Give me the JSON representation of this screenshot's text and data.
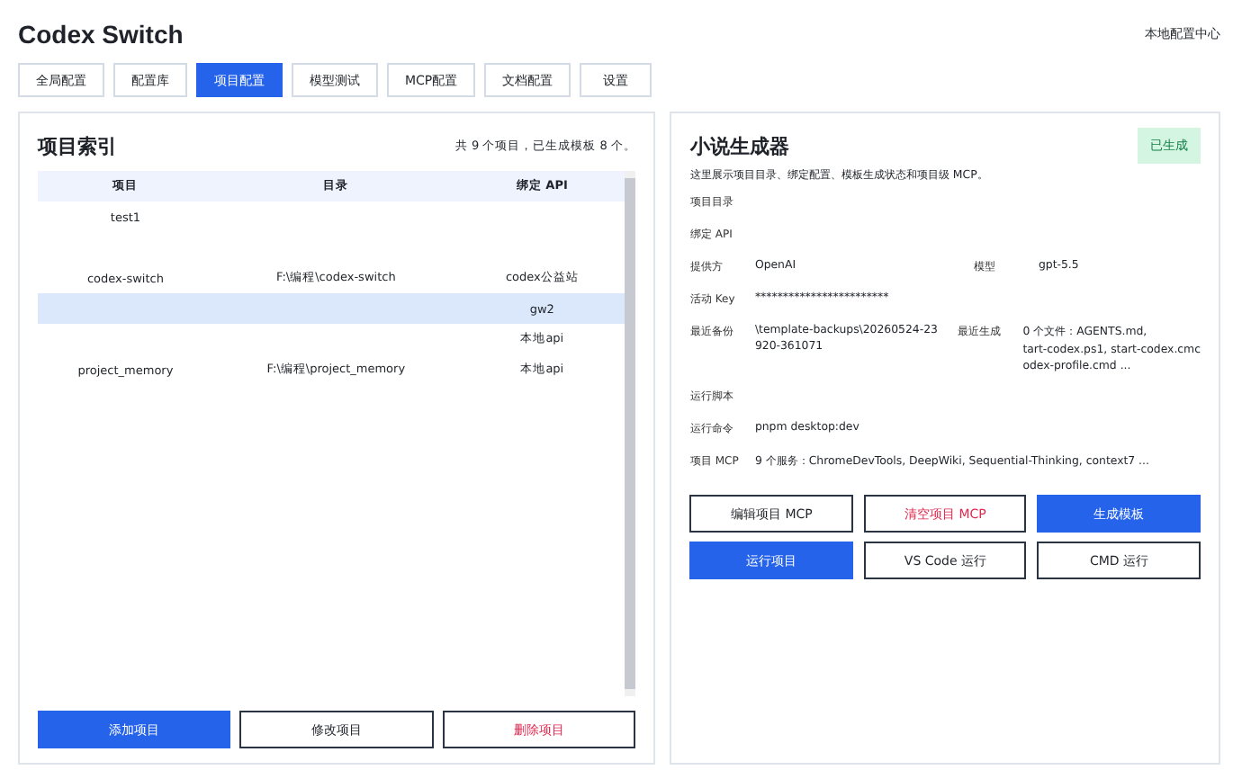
{
  "app": {
    "title": "Codex Switch",
    "subtitle": "本地配置中心"
  },
  "tabs": [
    {
      "label": "全局配置",
      "selected": false
    },
    {
      "label": "配置库",
      "selected": false
    },
    {
      "label": "项目配置",
      "selected": true
    },
    {
      "label": "模型测试",
      "selected": false
    },
    {
      "label": "MCP配置",
      "selected": false
    },
    {
      "label": "文档配置",
      "selected": false
    },
    {
      "label": "设置",
      "selected": false
    }
  ],
  "project_index": {
    "title": "项目索引",
    "summary": "共 9 个项目，已生成模板 8 个。",
    "table": {
      "columns": [
        "项目",
        "目录",
        "绑定 API"
      ],
      "rows": [
        {
          "cells": [
            "test1",
            "",
            ""
          ],
          "selected": false
        },
        {
          "cells": [
            "",
            "",
            ""
          ],
          "selected": false
        },
        {
          "cells": [
            "codex-switch",
            "F:\\编程\\codex-switch",
            "codex公益站"
          ],
          "selected": false
        },
        {
          "cells": [
            "",
            "",
            "gw2"
          ],
          "selected": true
        },
        {
          "cells": [
            "",
            "",
            "本地api"
          ],
          "selected": false
        },
        {
          "cells": [
            "project_memory",
            "F:\\编程\\project_memory",
            "本地api"
          ],
          "selected": false
        },
        {
          "cells": [
            "",
            "",
            ""
          ],
          "selected": false
        },
        {
          "cells": [
            "",
            "",
            ""
          ],
          "selected": false
        },
        {
          "cells": [
            "",
            "",
            ""
          ],
          "selected": false
        }
      ]
    },
    "buttons": [
      {
        "label": "添加项目",
        "kind": "primary"
      },
      {
        "label": "修改项目",
        "kind": "outline"
      },
      {
        "label": "删除项目",
        "kind": "danger"
      }
    ]
  },
  "project_detail": {
    "title": "小说生成器",
    "status": "已生成",
    "description": "这里展示项目目录、绑定配置、模板生成状态和项目级 MCP。",
    "fields": [
      {
        "label": "项目目录"
      },
      {
        "label": "绑定 API"
      },
      {
        "label": "提供方",
        "lines": [
          "OpenAI"
        ],
        "label2": "模型",
        "lines2": [
          "gpt-5.5"
        ]
      },
      {
        "label": "活动 Key",
        "lines": [
          "************************"
        ]
      },
      {
        "label": "最近备份",
        "lines": [
          "\\template-backups\\20260524-23",
          "920-361071"
        ],
        "label2": "最近生成",
        "lines2": [
          "0 个文件：AGENTS.md,",
          "tart-codex.ps1, start-codex.cmc",
          "odex-profile.cmd ..."
        ]
      },
      {
        "label": "运行脚本"
      },
      {
        "label": "运行命令",
        "lines": [
          "pnpm desktop:dev"
        ]
      },
      {
        "label": "项目 MCP",
        "lines": [
          "9 个服务：ChromeDevTools, DeepWiki, Sequential-Thinking, context7 ..."
        ]
      }
    ],
    "buttons": [
      {
        "label": "编辑项目 MCP",
        "kind": "outline"
      },
      {
        "label": "清空项目 MCP",
        "kind": "danger"
      },
      {
        "label": "生成模板",
        "kind": "primary"
      },
      {
        "label": "运行项目",
        "kind": "primary"
      },
      {
        "label": "VS Code 运行",
        "kind": "outline"
      },
      {
        "label": "CMD 运行",
        "kind": "outline"
      }
    ]
  }
}
